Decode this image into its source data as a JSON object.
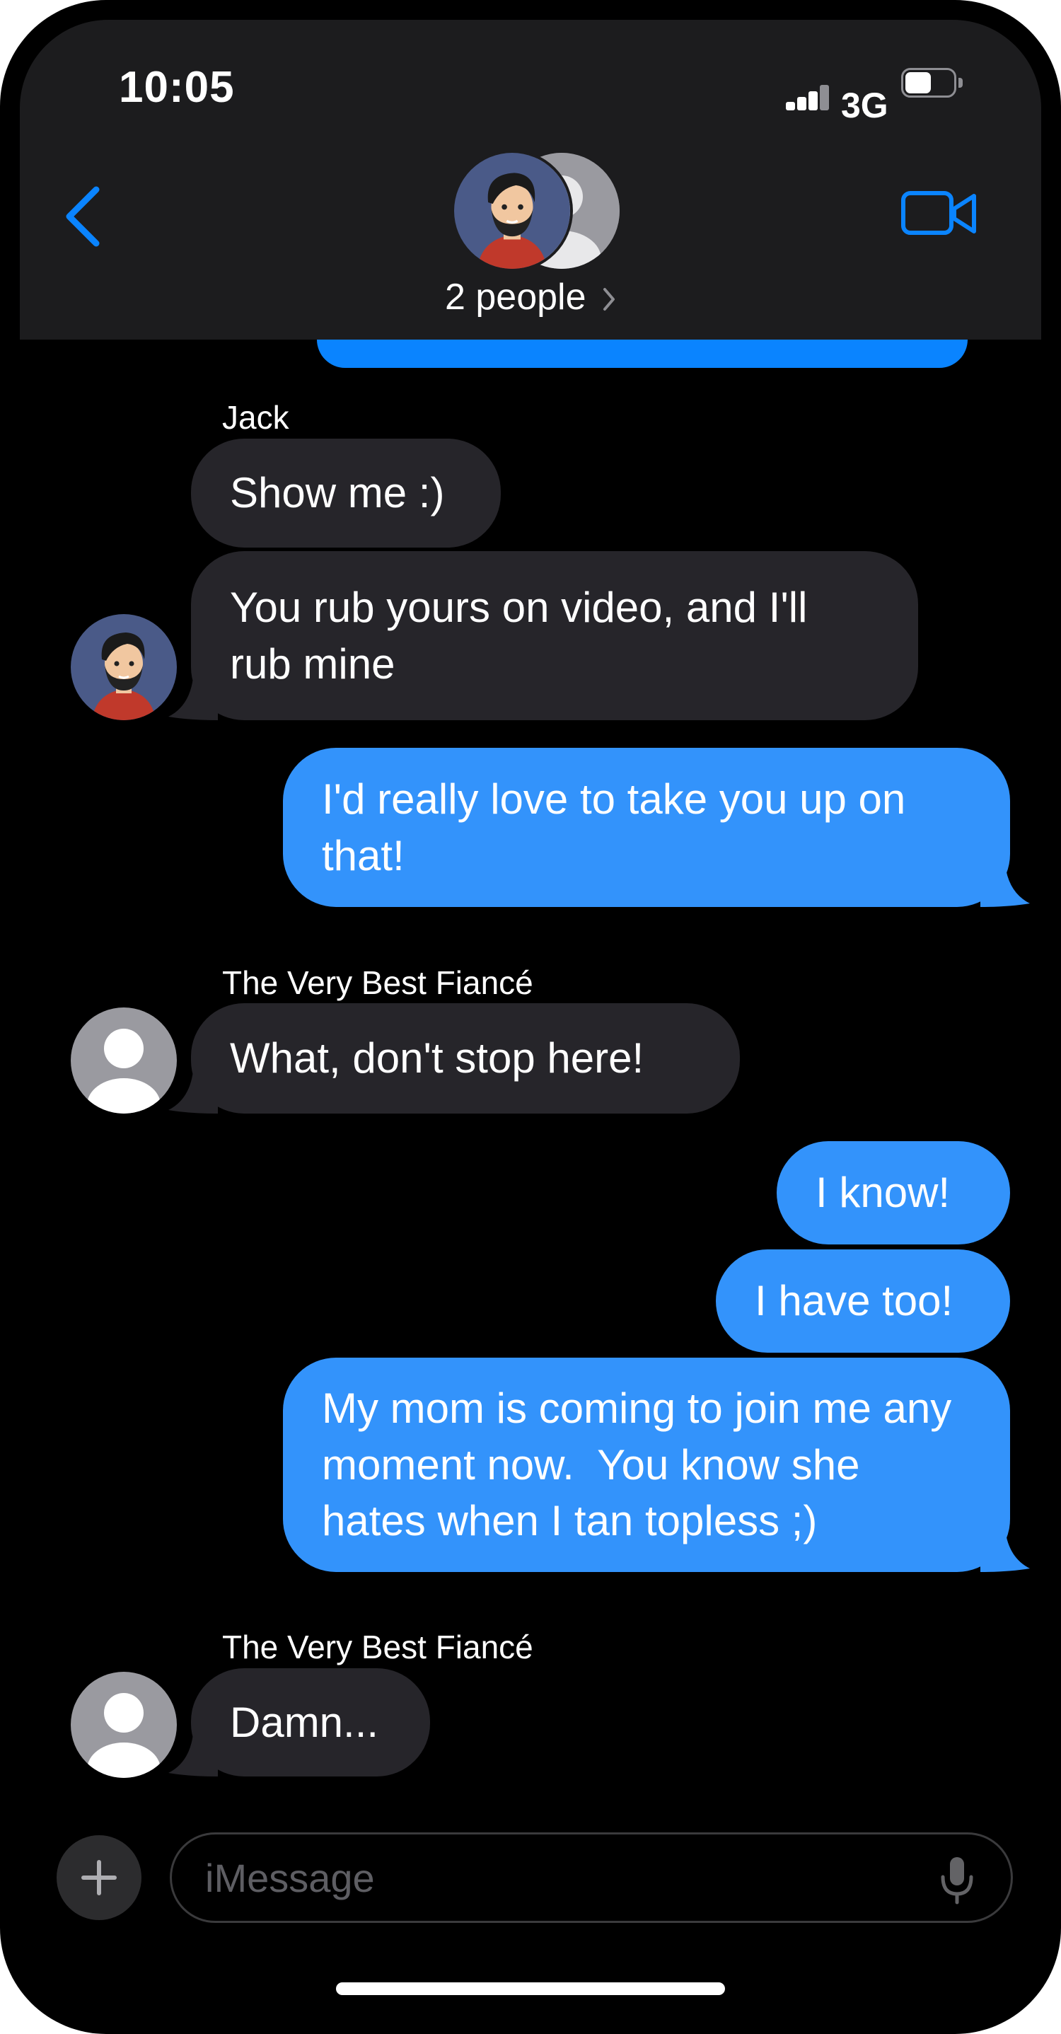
{
  "status_bar": {
    "time": "10:05",
    "network": "3G"
  },
  "header": {
    "people_label": "2 people"
  },
  "messages": [
    {
      "sender": "Jack",
      "direction": "incoming",
      "texts": [
        "Show me :)",
        "You rub yours on video, and I'll rub mine"
      ]
    },
    {
      "direction": "outgoing",
      "texts": [
        "I'd really love to take you up on that!"
      ]
    },
    {
      "sender": "The Very Best Fiancé",
      "direction": "incoming",
      "texts": [
        "What, don't stop here!"
      ]
    },
    {
      "direction": "outgoing",
      "texts": [
        "I know!",
        "I have too!",
        "My mom is coming to join me any moment now.  You know she hates when I tan topless ;)"
      ]
    },
    {
      "sender": "The Very Best Fiancé",
      "direction": "incoming",
      "texts": [
        "Damn..."
      ]
    }
  ],
  "input": {
    "placeholder": "iMessage"
  },
  "colors": {
    "outgoing_bubble": "#3393fb",
    "incoming_bubble": "#26252a",
    "accent": "#0a84ff",
    "header_bg": "#1c1c1e"
  }
}
